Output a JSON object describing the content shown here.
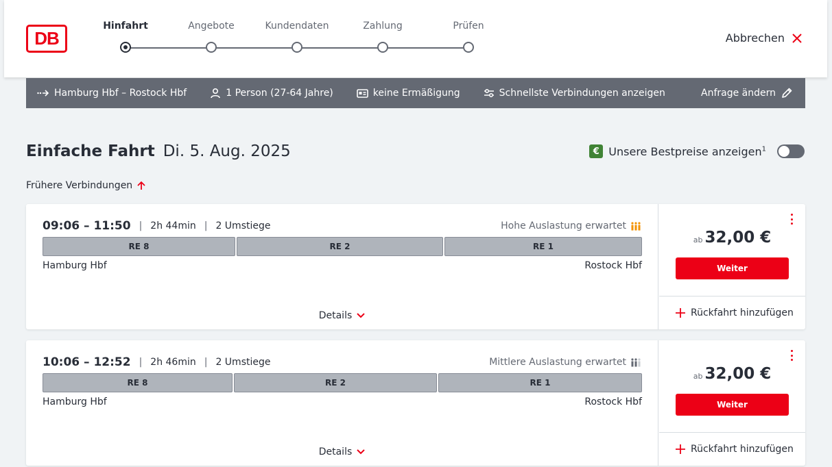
{
  "brand": {
    "logo_text": "DB"
  },
  "steps": [
    {
      "label": "Hinfahrt",
      "active": true
    },
    {
      "label": "Angebote",
      "active": false
    },
    {
      "label": "Kundendaten",
      "active": false
    },
    {
      "label": "Zahlung",
      "active": false
    },
    {
      "label": "Prüfen",
      "active": false
    }
  ],
  "header": {
    "cancel_label": "Abbrechen"
  },
  "query": {
    "route": "Hamburg Hbf – Rostock Hbf",
    "persons": "1 Person (27-64 Jahre)",
    "discount": "keine Ermäßigung",
    "filter": "Schnellste Verbindungen anzeigen",
    "change": "Anfrage ändern"
  },
  "page": {
    "title": "Einfache Fahrt",
    "date": "Di. 5. Aug. 2025",
    "best_prices_label": "Unsere Bestpreise anzeigen",
    "best_prices_sup": "1",
    "best_prices_enabled": false,
    "earlier_label": "Frühere Verbindungen"
  },
  "connections": [
    {
      "times": "09:06 – 11:50",
      "duration": "2h 44min",
      "transfers": "2 Umstiege",
      "load": "Hohe Auslastung erwartet",
      "load_color": "#f39200",
      "segments": [
        "RE 8",
        "RE 2",
        "RE 1"
      ],
      "from": "Hamburg Hbf",
      "to": "Rostock Hbf",
      "details": "Details",
      "price_prefix": "ab",
      "price": "32,00 €",
      "button": "Weiter",
      "return_label": "Rückfahrt hinzufügen"
    },
    {
      "times": "10:06 – 12:52",
      "duration": "2h 46min",
      "transfers": "2 Umstiege",
      "load": "Mittlere Auslastung erwartet",
      "load_color": "#646973",
      "segments": [
        "RE 8",
        "RE 2",
        "RE 1"
      ],
      "from": "Hamburg Hbf",
      "to": "Rostock Hbf",
      "details": "Details",
      "price_prefix": "ab",
      "price": "32,00 €",
      "button": "Weiter",
      "return_label": "Rückfahrt hinzufügen"
    }
  ],
  "colors": {
    "accent": "#ec0016",
    "bar": "#646973",
    "segment": "#afb4bb",
    "best_price": "#408335"
  }
}
